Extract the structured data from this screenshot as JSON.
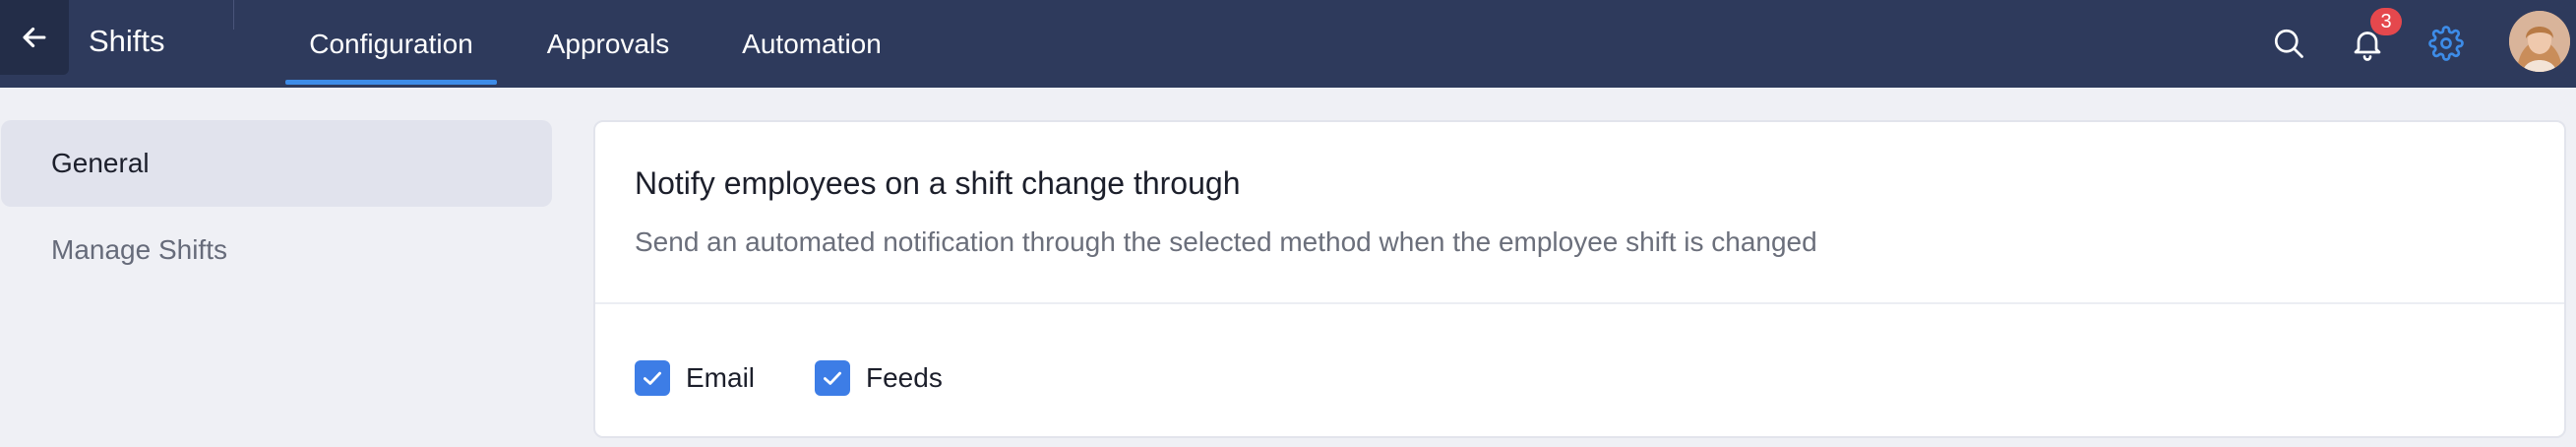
{
  "header": {
    "app_title": "Shifts",
    "back_icon": "arrow-left-icon",
    "tabs": [
      {
        "label": "Configuration",
        "active": true
      },
      {
        "label": "Approvals",
        "active": false
      },
      {
        "label": "Automation",
        "active": false
      }
    ],
    "notification_count": "3",
    "icons": [
      "search-icon",
      "bell-icon",
      "gear-icon"
    ],
    "accent_color": "#3d8ce8",
    "bar_color": "#2e3a5c"
  },
  "sidebar": {
    "items": [
      {
        "label": "General",
        "active": true
      },
      {
        "label": "Manage Shifts",
        "active": false
      }
    ]
  },
  "main": {
    "title": "Notify employees on a shift change through",
    "description": "Send an automated notification through the selected method when the employee shift is changed",
    "options": [
      {
        "label": "Email",
        "checked": true
      },
      {
        "label": "Feeds",
        "checked": true
      }
    ],
    "checkbox_color": "#3d7de6"
  }
}
